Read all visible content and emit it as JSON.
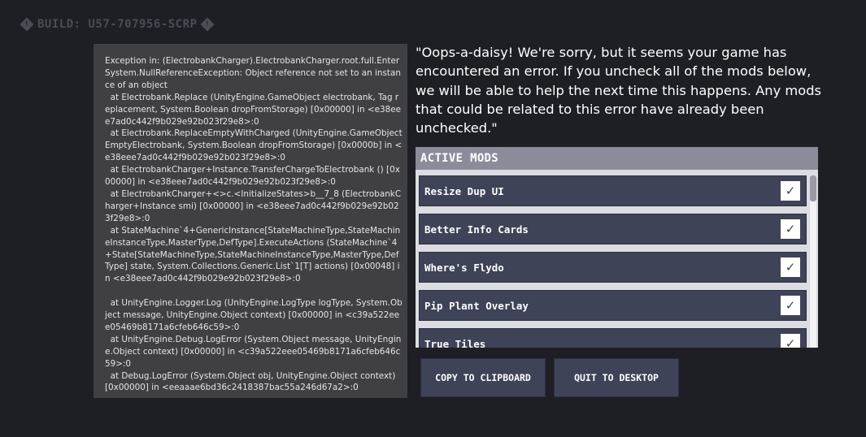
{
  "build": {
    "label": "BUILD: U57-707956-SCRP",
    "icon_left": "exclamation-diamond-icon",
    "icon_right": "exclamation-diamond-icon"
  },
  "stack_trace": "Exception in: (ElectrobankCharger).ElectrobankCharger.root.full.Enter\nSystem.NullReferenceException: Object reference not set to an instance of an object\n  at Electrobank.Replace (UnityEngine.GameObject electrobank, Tag replacement, System.Boolean dropFromStorage) [0x00000] in <e38eee7ad0c442f9b029e92b023f29e8>:0\n  at Electrobank.ReplaceEmptyWithCharged (UnityEngine.GameObject EmptyElectrobank, System.Boolean dropFromStorage) [0x0000b] in <e38eee7ad0c442f9b029e92b023f29e8>:0\n  at ElectrobankCharger+Instance.TransferChargeToElectrobank () [0x00000] in <e38eee7ad0c442f9b029e92b023f29e8>:0\n  at ElectrobankCharger+<>c.<InitializeStates>b__7_8 (ElectrobankCharger+Instance smi) [0x00000] in <e38eee7ad0c442f9b029e92b023f29e8>:0\n  at StateMachine`4+GenericInstance[StateMachineType,StateMachineInstanceType,MasterType,DefType].ExecuteActions (StateMachine`4+State[StateMachineType,StateMachineInstanceType,MasterType,DefType] state, System.Collections.Generic.List`1[T] actions) [0x00048] in <e38eee7ad0c442f9b029e92b023f29e8>:0\n\n  at UnityEngine.Logger.Log (UnityEngine.LogType logType, System.Object message, UnityEngine.Object context) [0x00000] in <c39a522eee05469b8171a6cfeb646c59>:0\n  at UnityEngine.Debug.LogError (System.Object message, UnityEngine.Object context) [0x00000] in <c39a522eee05469b8171a6cfeb646c59>:0\n  at Debug.LogError (System.Object obj, UnityEngine.Object context) [0x00000] in <eeaaae6bd36c2418387bac55a246d67a2>:0",
  "message": "\"Oops-a-daisy! We're sorry, but it seems your game has encountered an error. If you uncheck all of the mods below, we will be able to help the next time this happens. Any mods that could be related to this error have already been unchecked.\"",
  "mods": {
    "header": "ACTIVE MODS",
    "items": [
      {
        "label": "Resize Dup UI",
        "checked": true,
        "check_glyph": "✓"
      },
      {
        "label": "Better Info Cards",
        "checked": true,
        "check_glyph": "✓"
      },
      {
        "label": "Where's Flydo",
        "checked": true,
        "check_glyph": "✓"
      },
      {
        "label": "Pip Plant Overlay",
        "checked": true,
        "check_glyph": "✓"
      },
      {
        "label": "True Tiles",
        "checked": true,
        "check_glyph": "✓"
      }
    ]
  },
  "buttons": {
    "copy": "COPY TO CLIPBOARD",
    "quit": "QUIT TO DESKTOP"
  },
  "colors": {
    "background": "#1e1e25",
    "trace_panel": "#3f3f44",
    "mod_row": "#3e4357",
    "mods_header": "#8b8c9a"
  }
}
